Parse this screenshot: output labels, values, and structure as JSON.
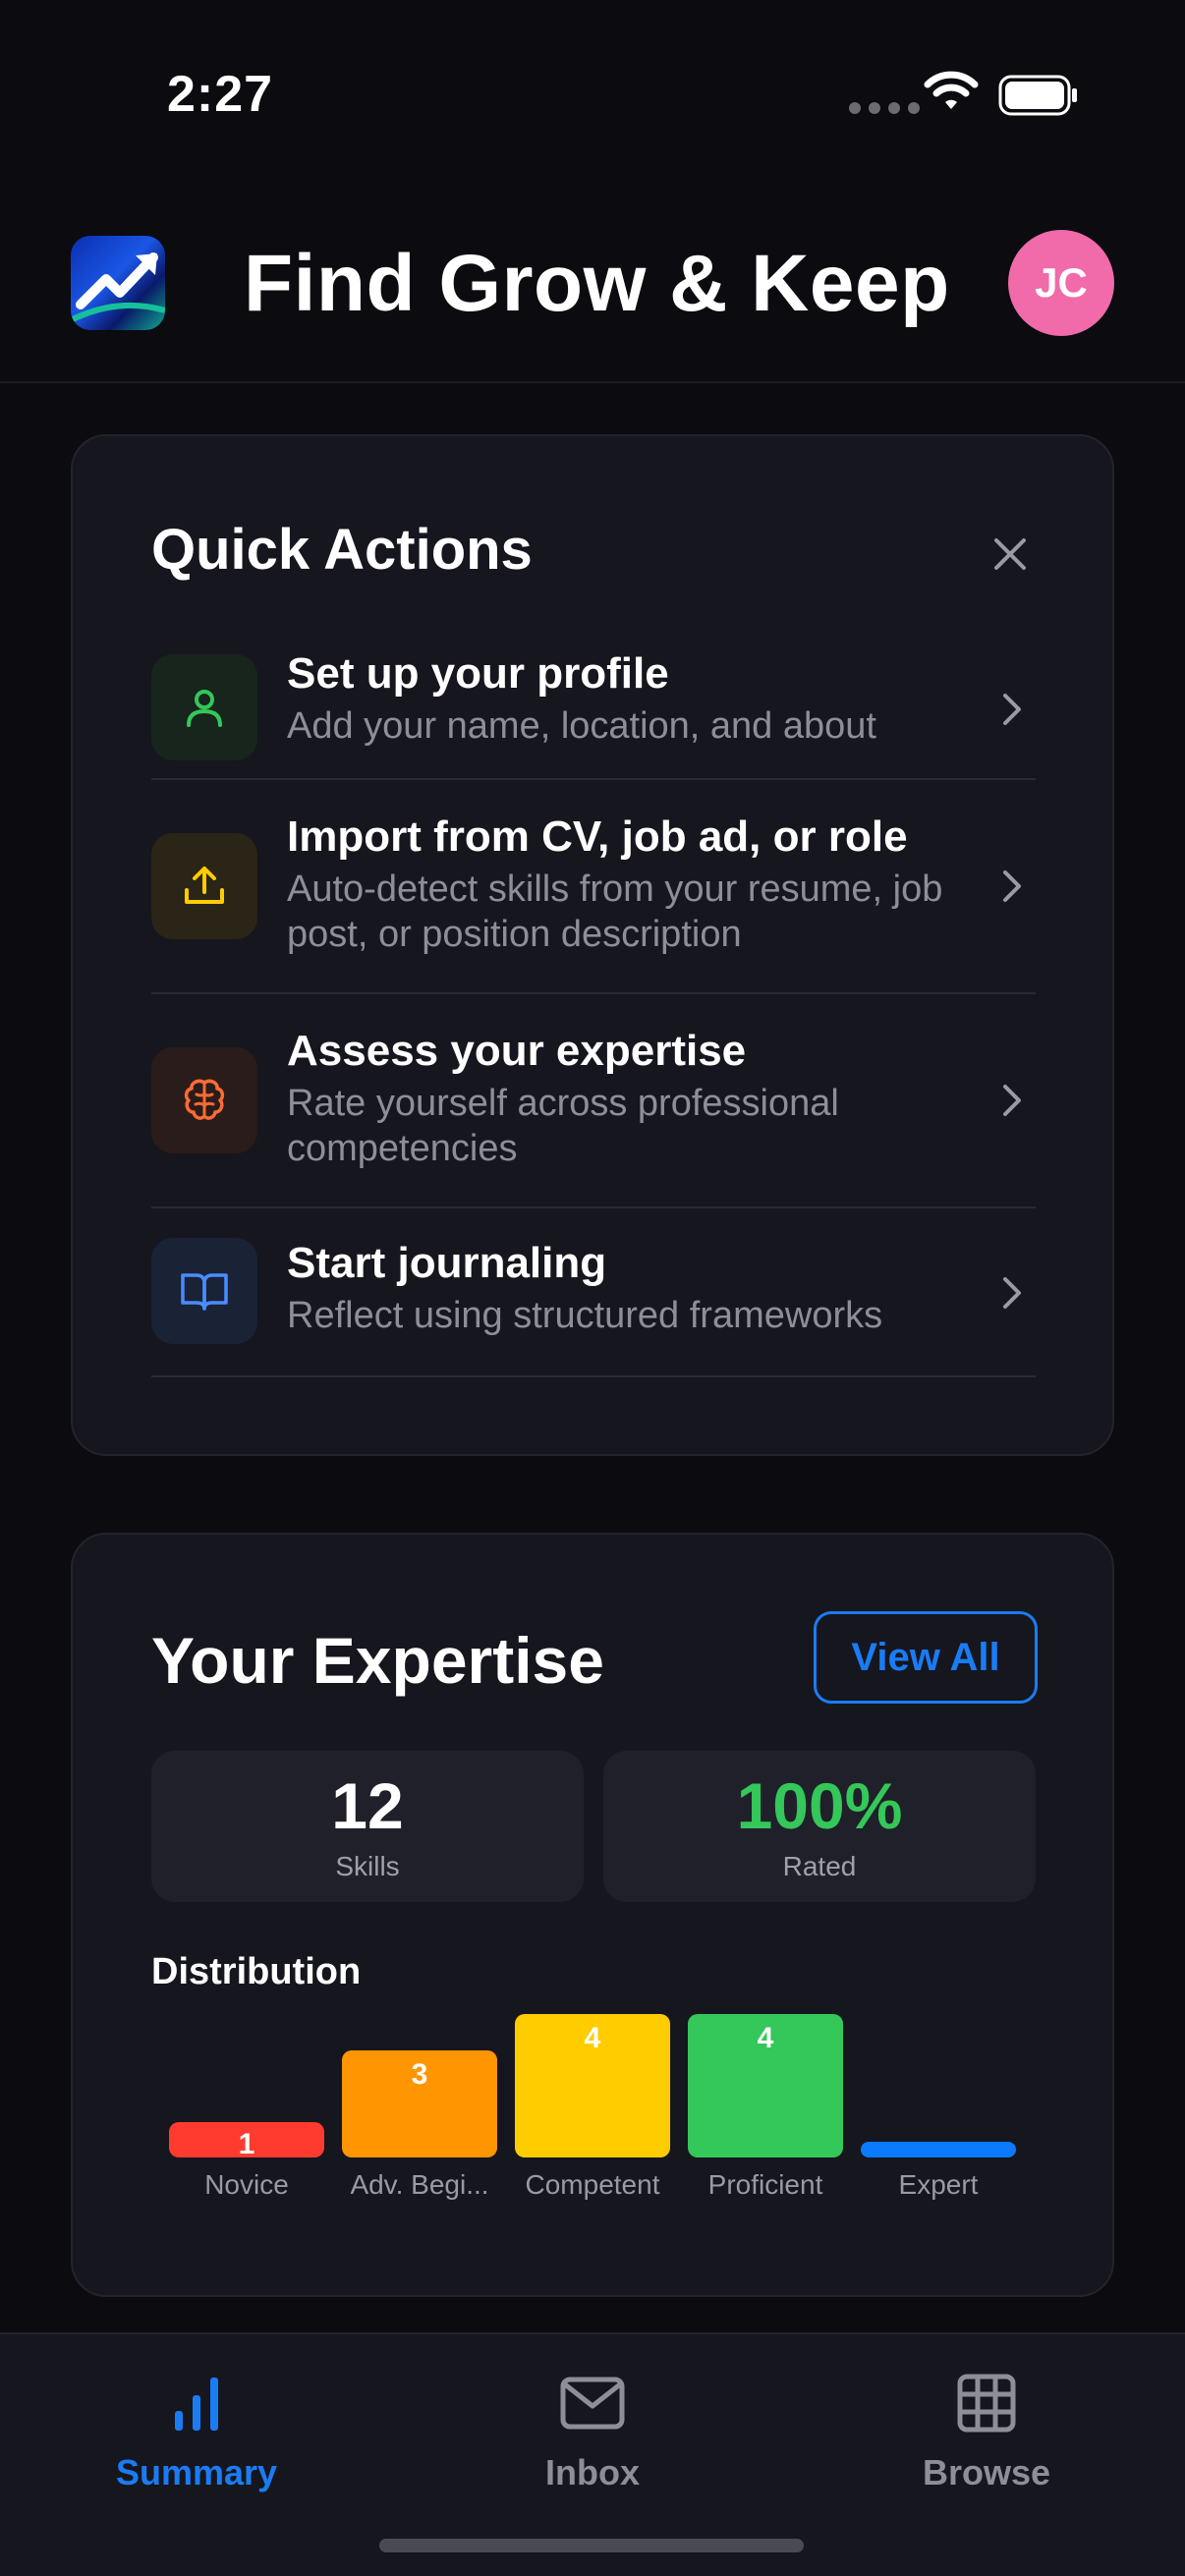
{
  "status_bar": {
    "time": "2:27"
  },
  "header": {
    "title": "Find Grow & Keep",
    "avatar_initials": "JC"
  },
  "quick_actions": {
    "title": "Quick Actions",
    "items": [
      {
        "label": "Set up your profile",
        "description": "Add your name, location, and about",
        "icon": "person-icon",
        "color": "#34c759"
      },
      {
        "label": "Import from CV, job ad, or role",
        "description": "Auto-detect skills from your resume, job post, or position description",
        "icon": "upload-icon",
        "color": "#ffcc00"
      },
      {
        "label": "Assess your expertise",
        "description": "Rate yourself across professional competencies",
        "icon": "brain-icon",
        "color": "#ff6b35"
      },
      {
        "label": "Start journaling",
        "description": "Reflect using structured frameworks",
        "icon": "book-icon",
        "color": "#4a8cff"
      }
    ]
  },
  "expertise": {
    "title": "Your Expertise",
    "view_all_label": "View All",
    "stats": [
      {
        "value": "12",
        "label": "Skills",
        "color": "#ffffff"
      },
      {
        "value": "100%",
        "label": "Rated",
        "color": "#34c759"
      }
    ],
    "distribution_label": "Distribution"
  },
  "chart_data": {
    "type": "bar",
    "categories": [
      "Novice",
      "Adv. Begi...",
      "Competent",
      "Proficient",
      "Expert"
    ],
    "values": [
      1,
      3,
      4,
      4,
      0
    ],
    "colors": [
      "#ff3b30",
      "#ff9500",
      "#ffcc00",
      "#34c759",
      "#0a7aff"
    ],
    "data_labels": [
      "1",
      "3",
      "4",
      "4",
      ""
    ]
  },
  "tabs": [
    {
      "label": "Summary",
      "icon": "bar-chart-icon",
      "active": true
    },
    {
      "label": "Inbox",
      "icon": "envelope-icon",
      "active": false
    },
    {
      "label": "Browse",
      "icon": "grid-icon",
      "active": false
    }
  ],
  "colors": {
    "accent": "#1a7cf5",
    "inactive_tab": "#8e8e98"
  }
}
